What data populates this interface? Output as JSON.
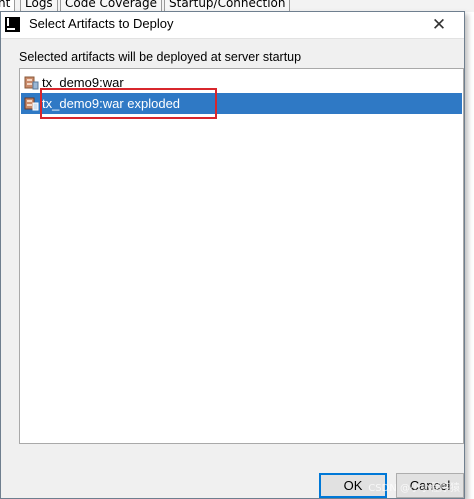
{
  "background_tabs": [
    "nt",
    "Logs",
    "Code Coverage",
    "Startup/Connection"
  ],
  "dialog": {
    "title": "Select Artifacts to Deploy",
    "close_glyph": "✕",
    "description": "Selected artifacts will be deployed at server startup",
    "artifacts": [
      {
        "label": "tx_demo9:war",
        "selected": false,
        "icon": "artifact-war-icon"
      },
      {
        "label": "tx_demo9:war exploded",
        "selected": true,
        "icon": "artifact-exploded-icon"
      }
    ],
    "ok_label": "OK",
    "cancel_label": "Cancel"
  },
  "colors": {
    "selection": "#2f79c5",
    "highlight_border": "#d8262c",
    "dialog_bg": "#f0f0f0"
  },
  "watermark": "CSDN @小小程序猿"
}
